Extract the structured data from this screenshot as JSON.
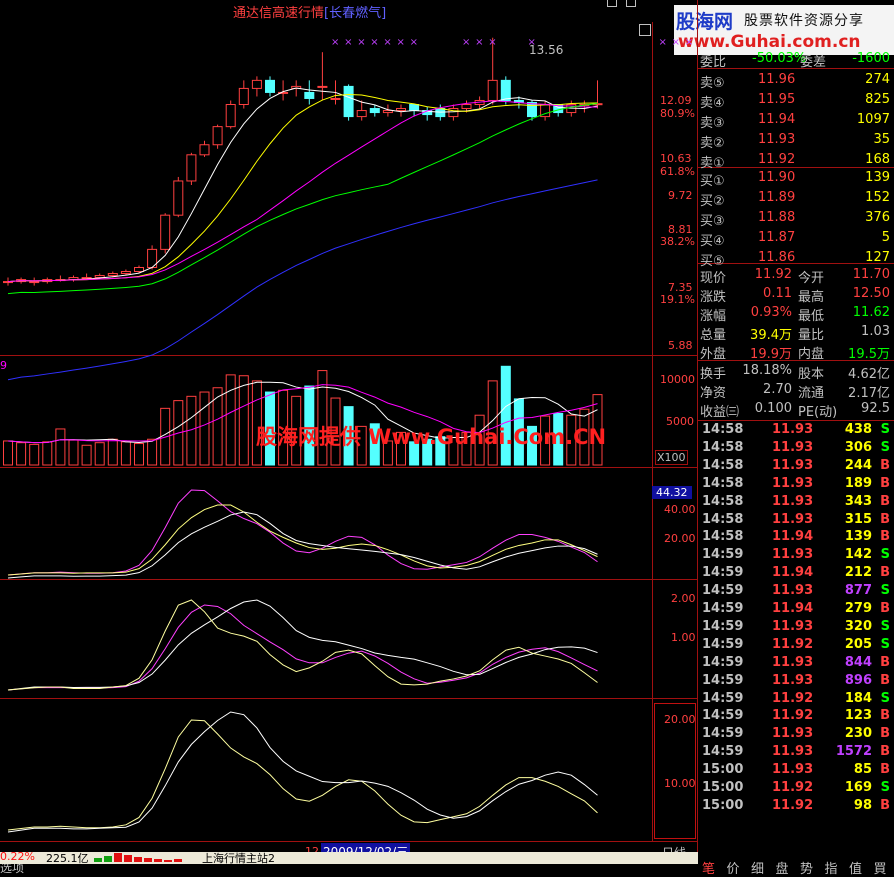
{
  "header": {
    "title": "通达信高速行情",
    "stock": "[长春燃气]"
  },
  "watermark_top": {
    "brand": "股海网",
    "slogan": "股票软件资源分享",
    "url": "www.Guhai.com.cn"
  },
  "watermark_mid": "股海网提供 Www.Guhai.Com.CN",
  "chart": {
    "price_axis": [
      "12.09",
      "80.9%",
      "10.63",
      "61.8%",
      "9.72",
      "8.81",
      "38.2%",
      "7.35",
      "19.1%",
      "5.88"
    ],
    "high_label": "13.56",
    "vol_axis": [
      "10000",
      "5000",
      "X100"
    ],
    "vol_prefix": "9",
    "ind1_axis": [
      "44.32",
      "40.00",
      "20.00"
    ],
    "ind2_axis": [
      "2.00",
      "1.00"
    ],
    "ind3_axis": [
      "20.00",
      "10.00"
    ],
    "bottom_num": "12",
    "bottom_date": "2009/12/02/三",
    "period": "日线",
    "prices": {
      "open": [
        7.5,
        7.5,
        7.5,
        7.5,
        7.55,
        7.55,
        7.6,
        7.6,
        7.65,
        7.7,
        7.75,
        7.85,
        8.3,
        9.15,
        10.0,
        10.65,
        10.9,
        11.35,
        11.9,
        12.3,
        12.5,
        12.2,
        12.3,
        12.2,
        12.35,
        12.05,
        12.35,
        11.6,
        11.8,
        11.7,
        11.75,
        11.9,
        11.75,
        11.8,
        11.6,
        11.8,
        11.9,
        12.0,
        12.5,
        12.0,
        11.95,
        11.6,
        11.9,
        11.7,
        11.9,
        11.9
      ],
      "close": [
        7.5,
        7.55,
        7.5,
        7.55,
        7.55,
        7.6,
        7.6,
        7.65,
        7.7,
        7.75,
        7.85,
        8.3,
        9.15,
        10.0,
        10.65,
        10.9,
        11.35,
        11.9,
        12.3,
        12.5,
        12.2,
        12.2,
        12.35,
        12.05,
        12.35,
        12.05,
        11.6,
        11.75,
        11.7,
        11.75,
        11.8,
        11.75,
        11.65,
        11.6,
        11.8,
        11.9,
        12.0,
        12.5,
        12.0,
        11.95,
        11.6,
        11.9,
        11.7,
        11.9,
        11.9,
        11.92
      ],
      "high": [
        7.6,
        7.6,
        7.6,
        7.6,
        7.65,
        7.65,
        7.7,
        7.7,
        7.75,
        7.8,
        7.9,
        8.4,
        9.2,
        10.1,
        10.7,
        11.0,
        11.4,
        12.0,
        12.5,
        12.6,
        12.6,
        12.5,
        12.5,
        12.5,
        13.2,
        12.5,
        12.4,
        12.0,
        11.9,
        11.9,
        11.9,
        11.9,
        11.85,
        11.9,
        11.9,
        12.0,
        12.1,
        13.56,
        12.6,
        12.1,
        12.0,
        12.0,
        11.9,
        12.0,
        12.0,
        12.5
      ],
      "low": [
        7.4,
        7.45,
        7.4,
        7.45,
        7.5,
        7.5,
        7.55,
        7.55,
        7.6,
        7.65,
        7.7,
        7.8,
        8.2,
        9.1,
        9.9,
        10.6,
        10.8,
        11.3,
        11.8,
        12.1,
        12.1,
        12.0,
        12.1,
        11.9,
        12.0,
        11.9,
        11.5,
        11.5,
        11.6,
        11.6,
        11.6,
        11.6,
        11.5,
        11.5,
        11.5,
        11.7,
        11.8,
        11.9,
        11.9,
        11.8,
        11.5,
        11.5,
        11.6,
        11.6,
        11.7,
        11.8
      ],
      "volume": [
        2800,
        2600,
        2400,
        2700,
        4200,
        2900,
        2300,
        2600,
        3000,
        2700,
        2500,
        3000,
        6600,
        7500,
        8000,
        8500,
        9000,
        10500,
        10400,
        9800,
        8500,
        8700,
        8000,
        9200,
        11000,
        7800,
        6800,
        4500,
        4800,
        2800,
        3800,
        2700,
        3000,
        3300,
        3200,
        3800,
        5800,
        9800,
        11500,
        7700,
        4500,
        5700,
        6000,
        5800,
        6500,
        8200
      ]
    }
  },
  "quote": {
    "weibi": {
      "label": "委比",
      "value": "-50.03%",
      "label2": "委差",
      "value2": "-1600"
    },
    "sell": [
      {
        "label": "卖⑤",
        "price": "11.96",
        "vol": "274"
      },
      {
        "label": "卖④",
        "price": "11.95",
        "vol": "825"
      },
      {
        "label": "卖③",
        "price": "11.94",
        "vol": "1097"
      },
      {
        "label": "卖②",
        "price": "11.93",
        "vol": "35"
      },
      {
        "label": "卖①",
        "price": "11.92",
        "vol": "168"
      }
    ],
    "buy": [
      {
        "label": "买①",
        "price": "11.90",
        "vol": "139"
      },
      {
        "label": "买②",
        "price": "11.89",
        "vol": "152"
      },
      {
        "label": "买③",
        "price": "11.88",
        "vol": "376"
      },
      {
        "label": "买④",
        "price": "11.87",
        "vol": "5"
      },
      {
        "label": "买⑤",
        "price": "11.86",
        "vol": "127"
      }
    ],
    "stats": [
      {
        "l1": "现价",
        "v1": "11.92",
        "l2": "今开",
        "v2": "11.70"
      },
      {
        "l1": "涨跌",
        "v1": "0.11",
        "l2": "最高",
        "v2": "12.50"
      },
      {
        "l1": "涨幅",
        "v1": "0.93%",
        "l2": "最低",
        "v2": "11.62"
      },
      {
        "l1": "总量",
        "v1": "39.4万",
        "l2": "量比",
        "v2": "1.03"
      },
      {
        "l1": "外盘",
        "v1": "19.9万",
        "l2": "内盘",
        "v2": "19.5万"
      }
    ],
    "stats2": [
      {
        "l1": "换手",
        "v1": "18.18%",
        "l2": "股本",
        "v2": "4.62亿"
      },
      {
        "l1": "净资",
        "v1": "2.70",
        "l2": "流通",
        "v2": "2.17亿"
      },
      {
        "l1": "收益㈢",
        "v1": "0.100",
        "l2": "PE(动)",
        "v2": "92.5"
      }
    ]
  },
  "ticks": [
    {
      "time": "14:58",
      "price": "11.93",
      "vol": "438",
      "side": "S"
    },
    {
      "time": "14:58",
      "price": "11.93",
      "vol": "306",
      "side": "S"
    },
    {
      "time": "14:58",
      "price": "11.93",
      "vol": "244",
      "side": "B"
    },
    {
      "time": "14:58",
      "price": "11.93",
      "vol": "189",
      "side": "B"
    },
    {
      "time": "14:58",
      "price": "11.93",
      "vol": "343",
      "side": "B"
    },
    {
      "time": "14:58",
      "price": "11.93",
      "vol": "315",
      "side": "B"
    },
    {
      "time": "14:58",
      "price": "11.94",
      "vol": "139",
      "side": "B"
    },
    {
      "time": "14:59",
      "price": "11.93",
      "vol": "142",
      "side": "S"
    },
    {
      "time": "14:59",
      "price": "11.94",
      "vol": "212",
      "side": "B"
    },
    {
      "time": "14:59",
      "price": "11.93",
      "vol": "877",
      "side": "S"
    },
    {
      "time": "14:59",
      "price": "11.94",
      "vol": "279",
      "side": "B"
    },
    {
      "time": "14:59",
      "price": "11.93",
      "vol": "320",
      "side": "S"
    },
    {
      "time": "14:59",
      "price": "11.92",
      "vol": "205",
      "side": "S"
    },
    {
      "time": "14:59",
      "price": "11.93",
      "vol": "844",
      "side": "B"
    },
    {
      "time": "14:59",
      "price": "11.93",
      "vol": "896",
      "side": "B"
    },
    {
      "time": "14:59",
      "price": "11.92",
      "vol": "184",
      "side": "S"
    },
    {
      "time": "14:59",
      "price": "11.92",
      "vol": "123",
      "side": "B"
    },
    {
      "time": "14:59",
      "price": "11.93",
      "vol": "230",
      "side": "B"
    },
    {
      "time": "14:59",
      "price": "11.93",
      "vol": "1572",
      "side": "B"
    },
    {
      "time": "15:00",
      "price": "11.93",
      "vol": "85",
      "side": "B"
    },
    {
      "time": "15:00",
      "price": "11.92",
      "vol": "169",
      "side": "S"
    },
    {
      "time": "15:00",
      "price": "11.92",
      "vol": "98",
      "side": "B"
    }
  ],
  "right_tabs": [
    "笔",
    "价",
    "细",
    "盘",
    "势",
    "指",
    "值",
    "買"
  ],
  "bottom_tab": "选项",
  "status": {
    "change": "0.22%",
    "amount": "225.1亿",
    "server": "上海行情主站2"
  },
  "colors": {
    "up": "#ff4040",
    "down": "#54ffff",
    "axis": "#a01010",
    "yellow": "#ffff00",
    "green": "#00ff00",
    "magenta": "#ff00ff"
  }
}
